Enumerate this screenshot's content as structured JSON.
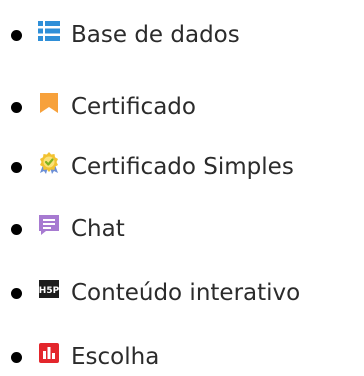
{
  "modules": [
    {
      "label": "Base de dados",
      "icon": "database-icon",
      "color": "#2f8fd8"
    },
    {
      "label": "Certificado",
      "icon": "bookmark-icon",
      "color": "#f7a13b"
    },
    {
      "label": "Certificado Simples",
      "icon": "award-ribbon-icon",
      "color": "#7fb21f"
    },
    {
      "label": "Chat",
      "icon": "chat-icon",
      "color": "#a77ad1"
    },
    {
      "label": "Conteúdo interativo",
      "icon": "h5p-icon",
      "color": "#1c1c1c"
    },
    {
      "label": "Escolha",
      "icon": "bar-chart-icon",
      "color": "#e3262c"
    }
  ]
}
